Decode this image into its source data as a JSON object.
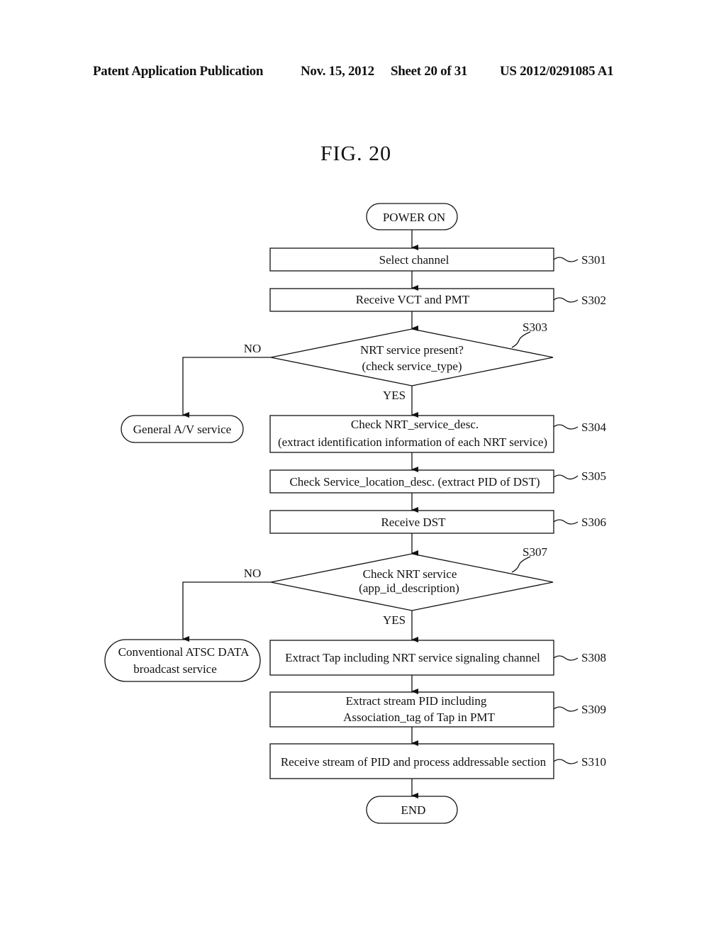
{
  "header": {
    "publication": "Patent Application Publication",
    "date": "Nov. 15, 2012",
    "sheet": "Sheet 20 of 31",
    "number": "US 2012/0291085 A1"
  },
  "figure": {
    "title": "FIG. 20"
  },
  "flowchart": {
    "start": "POWER ON",
    "end": "END",
    "steps": {
      "s301": {
        "id": "S301",
        "lines": [
          "Select channel"
        ]
      },
      "s302": {
        "id": "S302",
        "lines": [
          "Receive VCT and PMT"
        ]
      },
      "s303": {
        "id": "S303",
        "lines": [
          "NRT service present?",
          "(check service_type)"
        ]
      },
      "s304": {
        "id": "S304",
        "lines": [
          "Check NRT_service_desc.",
          "(extract identification information of each NRT service)"
        ]
      },
      "s305": {
        "id": "S305",
        "lines": [
          "Check Service_location_desc. (extract PID of DST)"
        ]
      },
      "s306": {
        "id": "S306",
        "lines": [
          "Receive DST"
        ]
      },
      "s307": {
        "id": "S307",
        "lines": [
          "Check NRT service",
          "(app_id_description)"
        ]
      },
      "s308": {
        "id": "S308",
        "lines": [
          "Extract Tap including NRT service signaling channel"
        ]
      },
      "s309": {
        "id": "S309",
        "lines": [
          "Extract stream PID including",
          "Association_tag of Tap in PMT"
        ]
      },
      "s310": {
        "id": "S310",
        "lines": [
          "Receive stream of PID and process addressable section"
        ]
      }
    },
    "branches": {
      "no1": "NO",
      "yes1": "YES",
      "no2": "NO",
      "yes2": "YES",
      "av_service": [
        "General A/V service"
      ],
      "atsc_service": [
        "Conventional ATSC DATA",
        "broadcast service"
      ]
    }
  }
}
